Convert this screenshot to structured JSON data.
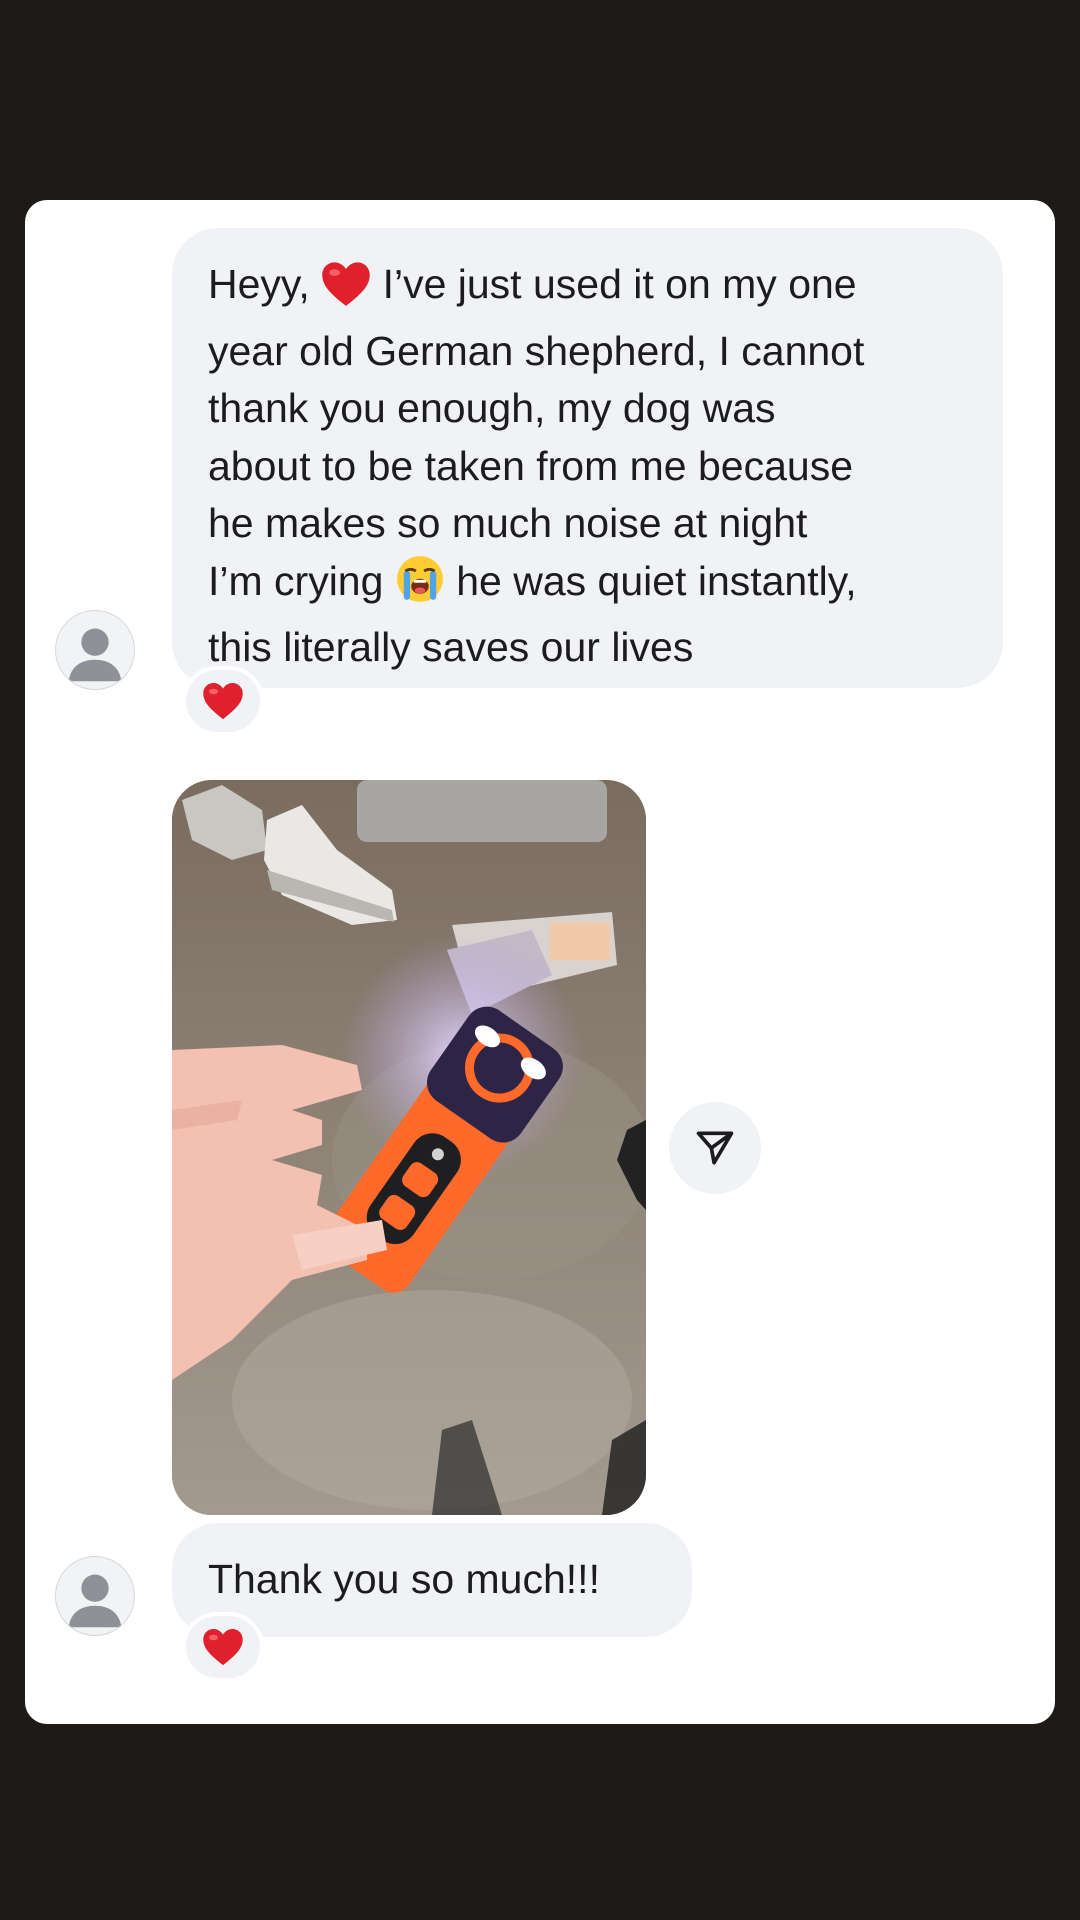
{
  "conversation": {
    "messages": [
      {
        "lines_before_heart": "Heyy,",
        "line1_after_heart": "I’ve just used it on my one",
        "line2": "year old German shepherd, I cannot",
        "line3": "thank you enough, my dog was",
        "line4": "about to be taken from me because",
        "line5": "he makes so much noise at night",
        "line6_before_emoji": "I’m crying",
        "line6_after_emoji": "he was quiet instantly,",
        "line7": "this literally saves our lives",
        "inline_emojis": [
          "red-heart",
          "loudly-crying-face"
        ],
        "reaction": "red-heart"
      },
      {
        "type": "photo",
        "description_icon": "photo-attachment",
        "action_icon": "share-paper-plane-icon"
      },
      {
        "text": "Thank you so much!!!",
        "reaction": "red-heart"
      }
    ]
  },
  "colors": {
    "page_background": "#1e1a18",
    "card": "#ffffff",
    "bubble": "#f0f2f5",
    "text": "#1c1c1e",
    "heart": "#e0202a"
  }
}
